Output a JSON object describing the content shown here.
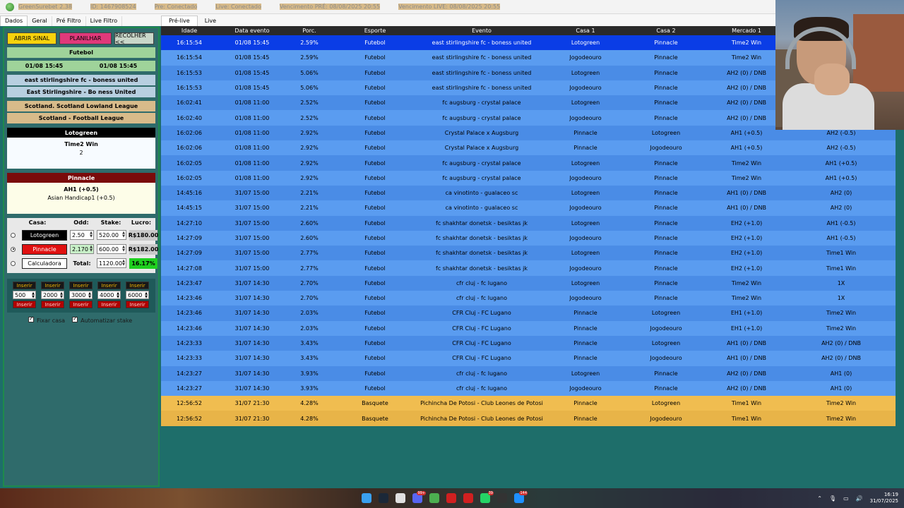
{
  "titlebar": {
    "app": "GreenSurebet 2.38",
    "id": "ID: 1467908524",
    "pre": "Pre: Conectado",
    "live": "Live: Conectado",
    "venc_pre": "Vencimento PRÉ: 08/08/2025 20:55",
    "venc_live": "Vencimento LIVE: 08/08/2025 20:55"
  },
  "tabs": [
    "Dados",
    "Geral",
    "Pré Filtro",
    "Live Filtro"
  ],
  "subtabs": [
    "Pré-live",
    "Live"
  ],
  "left": {
    "buttons": {
      "abrir": "ABRIR SINAL",
      "planilhar": "PLANILHAR",
      "recolher": "RECOLHER <<"
    },
    "sport": "Futebol",
    "date1": "01/08 15:45",
    "date2": "01/08 15:45",
    "event1": "east stirlingshire fc - boness united",
    "event2": "East Stirlingshire - Bo ness United",
    "league1": "Scotland. Scotland Lowland League",
    "league2": "Scotland - Football League",
    "house1": {
      "name": "Lotogreen",
      "market": "Time2 Win",
      "detail": "2"
    },
    "house2": {
      "name": "Pinnacle",
      "market": "AH1 (+0.5)",
      "detail": "Asian Handicap1 (+0.5)"
    },
    "calc": {
      "headers": {
        "casa": "Casa:",
        "odd": "Odd:",
        "stake": "Stake:",
        "lucro": "Lucro:"
      },
      "row1": {
        "house": "Lotogreen",
        "odd": "2.50",
        "stake": "520.00",
        "lucro": "R$180.00"
      },
      "row2": {
        "house": "Pinnacle",
        "odd": "2.170",
        "stake": "600.00",
        "lucro": "R$182.00"
      },
      "row3": {
        "house": "Calculadora",
        "total_label": "Total:",
        "total": "1120.00",
        "pct": "16.17%"
      }
    },
    "quick": {
      "insert": "Inserir",
      "values": [
        "500",
        "2000",
        "3000",
        "4000",
        "6000"
      ]
    },
    "checks": {
      "fixar": "Fixar casa",
      "auto": "Automatizar stake"
    }
  },
  "table": {
    "headers": [
      "Idade",
      "Data evento",
      "Porc.",
      "Esporte",
      "Evento",
      "Casa 1",
      "Casa 2",
      "Mercado 1",
      "Mercado 2"
    ],
    "rows": [
      [
        "16:15:54",
        "01/08 15:45",
        "2.59%",
        "Futebol",
        "east stirlingshire fc - boness united",
        "Lotogreen",
        "Pinnacle",
        "Time2 Win",
        "AH1 (+0.5)"
      ],
      [
        "16:15:54",
        "01/08 15:45",
        "2.59%",
        "Futebol",
        "east stirlingshire fc - boness united",
        "Jogodeouro",
        "Pinnacle",
        "Time2 Win",
        "AH1 (+0.5)"
      ],
      [
        "16:15:53",
        "01/08 15:45",
        "5.06%",
        "Futebol",
        "east stirlingshire fc - boness united",
        "Lotogreen",
        "Pinnacle",
        "AH2 (0) / DNB",
        "AH1 (0)"
      ],
      [
        "16:15:53",
        "01/08 15:45",
        "5.06%",
        "Futebol",
        "east stirlingshire fc - boness united",
        "Jogodeouro",
        "Pinnacle",
        "AH2 (0) / DNB",
        "AH1 (0)"
      ],
      [
        "16:02:41",
        "01/08 11:00",
        "2.52%",
        "Futebol",
        "fc augsburg - crystal palace",
        "Lotogreen",
        "Pinnacle",
        "AH2 (0) / DNB",
        "AH1 (0)"
      ],
      [
        "16:02:40",
        "01/08 11:00",
        "2.52%",
        "Futebol",
        "fc augsburg - crystal palace",
        "Jogodeouro",
        "Pinnacle",
        "AH2 (0) / DNB",
        "AH1 (0)"
      ],
      [
        "16:02:06",
        "01/08 11:00",
        "2.92%",
        "Futebol",
        "Crystal Palace x Augsburg",
        "Pinnacle",
        "Lotogreen",
        "AH1 (+0.5)",
        "AH2 (-0.5)"
      ],
      [
        "16:02:06",
        "01/08 11:00",
        "2.92%",
        "Futebol",
        "Crystal Palace x Augsburg",
        "Pinnacle",
        "Jogodeouro",
        "AH1 (+0.5)",
        "AH2 (-0.5)"
      ],
      [
        "16:02:05",
        "01/08 11:00",
        "2.92%",
        "Futebol",
        "fc augsburg - crystal palace",
        "Lotogreen",
        "Pinnacle",
        "Time2 Win",
        "AH1 (+0.5)"
      ],
      [
        "16:02:05",
        "01/08 11:00",
        "2.92%",
        "Futebol",
        "fc augsburg - crystal palace",
        "Jogodeouro",
        "Pinnacle",
        "Time2 Win",
        "AH1 (+0.5)"
      ],
      [
        "14:45:16",
        "31/07 15:00",
        "2.21%",
        "Futebol",
        "ca vinotinto - gualaceo sc",
        "Lotogreen",
        "Pinnacle",
        "AH1 (0) / DNB",
        "AH2 (0)"
      ],
      [
        "14:45:15",
        "31/07 15:00",
        "2.21%",
        "Futebol",
        "ca vinotinto - gualaceo sc",
        "Jogodeouro",
        "Pinnacle",
        "AH1 (0) / DNB",
        "AH2 (0)"
      ],
      [
        "14:27:10",
        "31/07 15:00",
        "2.60%",
        "Futebol",
        "fc shakhtar donetsk - besiktas jk",
        "Lotogreen",
        "Pinnacle",
        "EH2 (+1.0)",
        "AH1 (-0.5)"
      ],
      [
        "14:27:09",
        "31/07 15:00",
        "2.60%",
        "Futebol",
        "fc shakhtar donetsk - besiktas jk",
        "Jogodeouro",
        "Pinnacle",
        "EH2 (+1.0)",
        "AH1 (-0.5)"
      ],
      [
        "14:27:09",
        "31/07 15:00",
        "2.77%",
        "Futebol",
        "fc shakhtar donetsk - besiktas jk",
        "Lotogreen",
        "Pinnacle",
        "EH2 (+1.0)",
        "Time1 Win"
      ],
      [
        "14:27:08",
        "31/07 15:00",
        "2.77%",
        "Futebol",
        "fc shakhtar donetsk - besiktas jk",
        "Jogodeouro",
        "Pinnacle",
        "EH2 (+1.0)",
        "Time1 Win"
      ],
      [
        "14:23:47",
        "31/07 14:30",
        "2.70%",
        "Futebol",
        "cfr cluj - fc lugano",
        "Lotogreen",
        "Pinnacle",
        "Time2 Win",
        "1X"
      ],
      [
        "14:23:46",
        "31/07 14:30",
        "2.70%",
        "Futebol",
        "cfr cluj - fc lugano",
        "Jogodeouro",
        "Pinnacle",
        "Time2 Win",
        "1X"
      ],
      [
        "14:23:46",
        "31/07 14:30",
        "2.03%",
        "Futebol",
        "CFR Cluj - FC Lugano",
        "Pinnacle",
        "Lotogreen",
        "EH1 (+1.0)",
        "Time2 Win"
      ],
      [
        "14:23:46",
        "31/07 14:30",
        "2.03%",
        "Futebol",
        "CFR Cluj - FC Lugano",
        "Pinnacle",
        "Jogodeouro",
        "EH1 (+1.0)",
        "Time2 Win"
      ],
      [
        "14:23:33",
        "31/07 14:30",
        "3.43%",
        "Futebol",
        "CFR Cluj - FC Lugano",
        "Pinnacle",
        "Lotogreen",
        "AH1 (0) / DNB",
        "AH2 (0) / DNB"
      ],
      [
        "14:23:33",
        "31/07 14:30",
        "3.43%",
        "Futebol",
        "CFR Cluj - FC Lugano",
        "Pinnacle",
        "Jogodeouro",
        "AH1 (0) / DNB",
        "AH2 (0) / DNB"
      ],
      [
        "14:23:27",
        "31/07 14:30",
        "3.93%",
        "Futebol",
        "cfr cluj - fc lugano",
        "Lotogreen",
        "Pinnacle",
        "AH2 (0) / DNB",
        "AH1 (0)"
      ],
      [
        "14:23:27",
        "31/07 14:30",
        "3.93%",
        "Futebol",
        "cfr cluj - fc lugano",
        "Jogodeouro",
        "Pinnacle",
        "AH2 (0) / DNB",
        "AH1 (0)"
      ],
      [
        "12:56:52",
        "31/07 21:30",
        "4.28%",
        "Basquete",
        "Pichincha De Potosi - Club Leones de Potosi",
        "Pinnacle",
        "Lotogreen",
        "Time1 Win",
        "Time2 Win"
      ],
      [
        "12:56:52",
        "31/07 21:30",
        "4.28%",
        "Basquete",
        "Pichincha De Potosi - Club Leones de Potosi",
        "Pinnacle",
        "Jogodeouro",
        "Time1 Win",
        "Time2 Win"
      ]
    ]
  },
  "tray": {
    "time": "16:19",
    "date": "31/07/2025"
  },
  "taskbar_badges": {
    "discord": "99+",
    "whatsapp": "39",
    "edge": "144"
  }
}
